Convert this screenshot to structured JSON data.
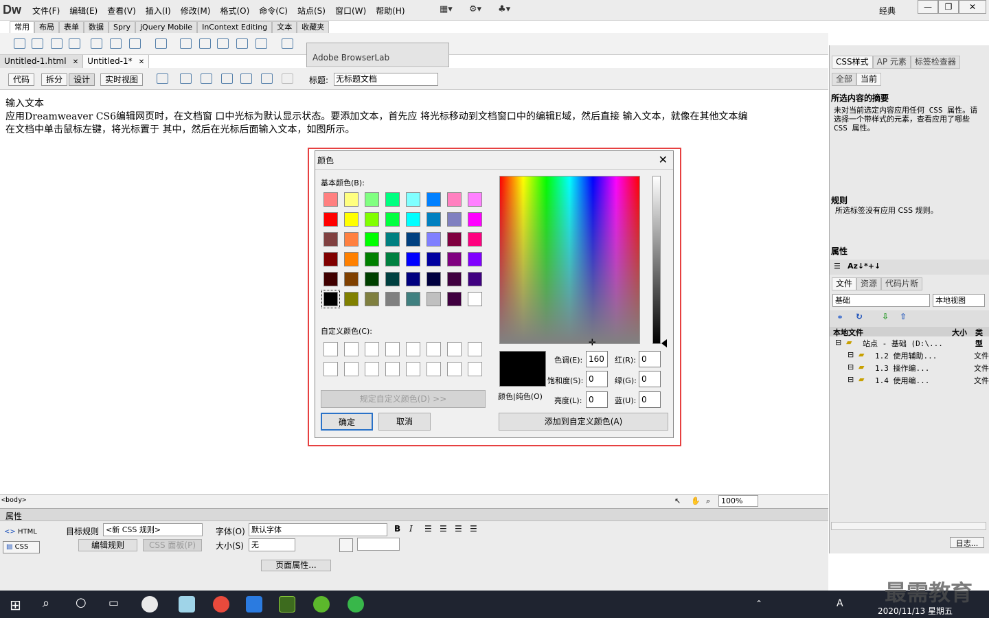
{
  "app": {
    "logo": "Dw",
    "workspace": "经典"
  },
  "menus": [
    "文件(F)",
    "编辑(E)",
    "查看(V)",
    "插入(I)",
    "修改(M)",
    "格式(O)",
    "命令(C)",
    "站点(S)",
    "窗口(W)",
    "帮助(H)"
  ],
  "insert_tabs": [
    "常用",
    "布局",
    "表单",
    "数据",
    "Spry",
    "jQuery Mobile",
    "InContext Editing",
    "文本",
    "收藏夹"
  ],
  "browserlab": "Adobe BrowserLab",
  "doc_tabs": [
    "Untitled-1.html",
    "Untitled-1*"
  ],
  "views": [
    "代码",
    "拆分",
    "设计",
    "实时视图"
  ],
  "title_label": "标题:",
  "title_value": "无标题文档",
  "doc": {
    "line1": "输入文本",
    "line2": "应用Dreamweaver CS6编辑网页时，在文档窗 口中光标为默认显示状态。要添加文本，首先应 将光标移动到文档窗口中的编辑E域，然后直接 输入文本，就像在其他文本编",
    "line3": "在文档中单击鼠标左键，将光标置于 其中，然后在光标后面输入文本，如图所示。"
  },
  "dialog": {
    "title": "颜色",
    "basic_label": "基本颜色(B):",
    "custom_label": "自定义颜色(C):",
    "define_button": "规定自定义颜色(D) >>",
    "ok": "确定",
    "cancel": "取消",
    "solid_label": "颜色|纯色(O)",
    "hue_label": "色调(E):",
    "hue": "160",
    "sat_label": "饱和度(S):",
    "sat": "0",
    "lum_label": "亮度(L):",
    "lum": "0",
    "red_label": "红(R):",
    "red": "0",
    "green_label": "绿(G):",
    "green": "0",
    "blue_label": "蓝(U):",
    "blue": "0",
    "add_custom": "添加到自定义颜色(A)",
    "swatches": [
      "#ff8080",
      "#ffff80",
      "#80ff80",
      "#00ff80",
      "#80ffff",
      "#0080ff",
      "#ff80c0",
      "#ff80ff",
      "#ff0000",
      "#ffff00",
      "#80ff00",
      "#00ff40",
      "#00ffff",
      "#0080c0",
      "#8080c0",
      "#ff00ff",
      "#804040",
      "#ff8040",
      "#00ff00",
      "#008080",
      "#004080",
      "#8080ff",
      "#800040",
      "#ff0080",
      "#800000",
      "#ff8000",
      "#008000",
      "#008040",
      "#0000ff",
      "#0000a0",
      "#800080",
      "#8000ff",
      "#400000",
      "#804000",
      "#004000",
      "#004040",
      "#000080",
      "#000040",
      "#400040",
      "#400080",
      "#000000",
      "#808000",
      "#808040",
      "#808080",
      "#408080",
      "#c0c0c0",
      "#400040",
      "#ffffff"
    ]
  },
  "right": {
    "tabs1": [
      "CSS样式",
      "AP 元素",
      "标签检查器"
    ],
    "mode": [
      "全部",
      "当前"
    ],
    "summary_head": "所选内容的摘要",
    "summary_text": "未对当前选定内容应用任何 CSS 属性。请选择一个带样式的元素，查看应用了哪些 CSS 属性。",
    "rules_head": "规则",
    "rules_text": "所选标签没有应用 CSS 规则。",
    "props_head": "属性",
    "tabs2": [
      "文件",
      "资源",
      "代码片断"
    ],
    "site": "基础",
    "view": "本地视图",
    "col_local": "本地文件",
    "col_size": "大小",
    "col_type": "类型",
    "tree": [
      {
        "label": "站点 - 基础 (D:\\...",
        "type": ""
      },
      {
        "label": "1.2 使用辅助...",
        "type": "文件"
      },
      {
        "label": "1.3 操作编...",
        "type": "文件"
      },
      {
        "label": "1.4 使用编...",
        "type": "文件"
      }
    ],
    "log": "日志..."
  },
  "status": {
    "tag": "<body>",
    "zoom": "100%"
  },
  "props": {
    "title": "属性",
    "html": "HTML",
    "css": "CSS",
    "target_label": "目标规则",
    "target": "<新 CSS 规则>",
    "edit_rule": "编辑规则",
    "css_panel": "CSS 面板(P)",
    "font_label": "字体(O)",
    "font": "默认字体",
    "size_label": "大小(S)",
    "size": "无",
    "page_props": "页面属性..."
  },
  "taskbar": {
    "date": "2020/11/13 星期五",
    "watermark": "最需教育",
    "ime": "A"
  }
}
